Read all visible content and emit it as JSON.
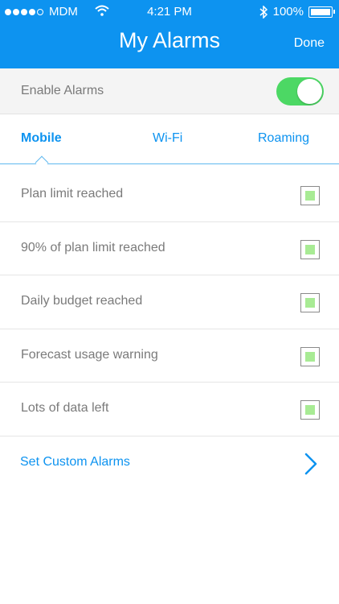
{
  "status_bar": {
    "carrier": "MDM",
    "time": "4:21 PM",
    "battery": "100%",
    "signal_dots_filled": 4,
    "signal_dots_total": 5
  },
  "header": {
    "title": "My Alarms",
    "done_label": "Done"
  },
  "enable_alarms": {
    "label": "Enable Alarms",
    "enabled": true
  },
  "tabs": [
    {
      "label": "Mobile",
      "active": true
    },
    {
      "label": "Wi-Fi",
      "active": false
    },
    {
      "label": "Roaming",
      "active": false
    }
  ],
  "alarms": [
    {
      "label": "Plan limit reached",
      "checked": true
    },
    {
      "label": "90% of plan limit reached",
      "checked": true
    },
    {
      "label": "Daily budget reached",
      "checked": true
    },
    {
      "label": "Forecast usage warning",
      "checked": true
    },
    {
      "label": "Lots of data left",
      "checked": true
    }
  ],
  "custom_alarms": {
    "label": "Set Custom Alarms",
    "icon": "chevron-right-icon"
  },
  "colors": {
    "header_blue": "#0d93f0",
    "toggle_green": "#4cd864",
    "check_green": "#a8eb94",
    "text_gray": "#7a7a7a"
  }
}
